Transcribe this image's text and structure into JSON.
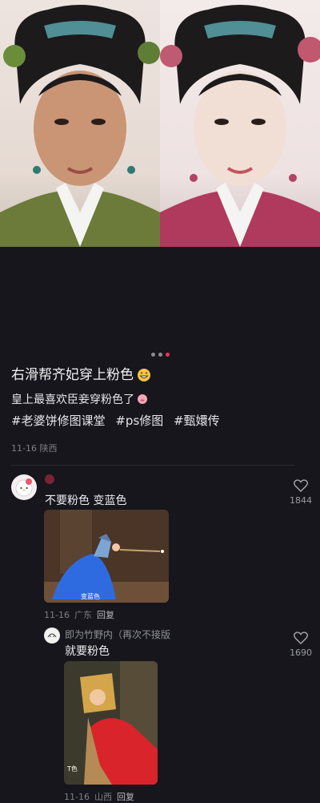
{
  "post": {
    "title": "右滑帮齐妃穿上粉色",
    "subtitle": "皇上最喜欢臣妾穿粉色了",
    "tags": [
      "#老婆饼修图课堂",
      "#ps修图",
      "#甄嬛传"
    ],
    "meta": "11-16 陕西"
  },
  "carousel": {
    "total": 3,
    "active": 2
  },
  "colors": {
    "accent": "#ff2b54",
    "background": "#16161c"
  },
  "comments": [
    {
      "text": "不要粉色 变蓝色",
      "likes": "1844",
      "image_caption": "变蓝色",
      "date": "11-16",
      "location": "广东",
      "reply_label": "回复"
    }
  ],
  "reply": {
    "author": "即为竹野内（再次不接版",
    "text": "就要粉色",
    "likes": "1690",
    "image_caption": "T色",
    "date": "11-16",
    "location": "山西",
    "reply_label": "回复"
  }
}
